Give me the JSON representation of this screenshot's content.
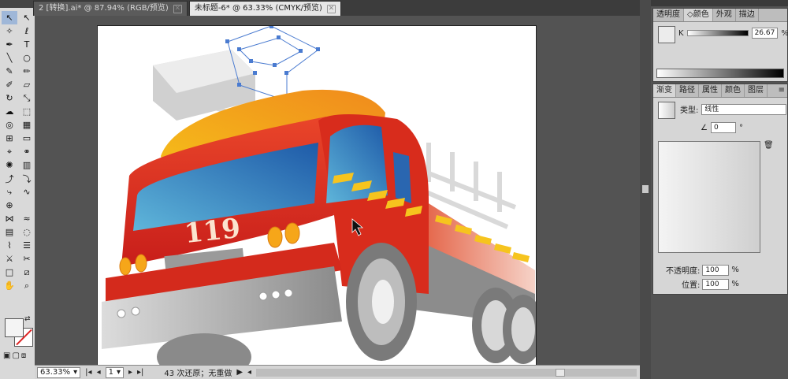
{
  "document_tabs": [
    {
      "label": "2 [转换].ai* @ 87.94% (RGB/预览)",
      "active": false
    },
    {
      "label": "未标题-6* @ 63.33% (CMYK/预览)",
      "active": true
    }
  ],
  "close_glyph": "✕",
  "toolbar": {
    "tools": [
      {
        "name": "selection-tool-icon",
        "glyph": "↖"
      },
      {
        "name": "direct-selection-tool-icon",
        "glyph": "↖"
      },
      {
        "name": "magic-wand-tool-icon",
        "glyph": "✧"
      },
      {
        "name": "lasso-tool-icon",
        "glyph": "ℓ"
      },
      {
        "name": "pen-tool-icon",
        "glyph": "✒"
      },
      {
        "name": "type-tool-icon",
        "glyph": "T"
      },
      {
        "name": "line-tool-icon",
        "glyph": "╲"
      },
      {
        "name": "ellipse-tool-icon",
        "glyph": "○"
      },
      {
        "name": "brush-tool-icon",
        "glyph": "✎"
      },
      {
        "name": "pencil-tool-icon",
        "glyph": "✏"
      },
      {
        "name": "blob-brush-tool-icon",
        "glyph": "✐"
      },
      {
        "name": "eraser-tool-icon",
        "glyph": "▱"
      },
      {
        "name": "rotate-tool-icon",
        "glyph": "↻"
      },
      {
        "name": "scale-tool-icon",
        "glyph": "⤡"
      },
      {
        "name": "warp-tool-icon",
        "glyph": "☁"
      },
      {
        "name": "free-transform-tool-icon",
        "glyph": "⬚"
      },
      {
        "name": "shape-builder-tool-icon",
        "glyph": "◎"
      },
      {
        "name": "perspective-grid-tool-icon",
        "glyph": "▦"
      },
      {
        "name": "mesh-tool-icon",
        "glyph": "⊞"
      },
      {
        "name": "gradient-tool-icon",
        "glyph": "▭"
      },
      {
        "name": "eyedropper-tool-icon",
        "glyph": "⌖"
      },
      {
        "name": "blend-tool-icon",
        "glyph": "⚭"
      },
      {
        "name": "symbol-sprayer-tool-icon",
        "glyph": "✺"
      },
      {
        "name": "column-graph-tool-icon",
        "glyph": "▥"
      },
      {
        "name": "add-anchor-tool-icon",
        "glyph": "⤴"
      },
      {
        "name": "convert-anchor-tool-icon",
        "glyph": "⤵"
      },
      {
        "name": "width-tool-icon",
        "glyph": "⤷"
      },
      {
        "name": "smooth-tool-icon",
        "glyph": "∿"
      },
      {
        "name": "target-tool-icon",
        "glyph": "⊕"
      },
      {
        "name": "blank-slot-icon",
        "glyph": ""
      },
      {
        "name": "envelope-tool-icon",
        "glyph": "⋈"
      },
      {
        "name": "wave-tool-icon",
        "glyph": "≈"
      },
      {
        "name": "grid-tool-icon",
        "glyph": "▤"
      },
      {
        "name": "twirl-tool-icon",
        "glyph": "◌"
      },
      {
        "name": "chart-tool-icon",
        "glyph": "⌇"
      },
      {
        "name": "list-tool-icon",
        "glyph": "☰"
      },
      {
        "name": "knife-tool-icon",
        "glyph": "⚔"
      },
      {
        "name": "scissors-tool-icon",
        "glyph": "✂"
      },
      {
        "name": "artboard-tool-icon",
        "glyph": "□"
      },
      {
        "name": "slice-tool-icon",
        "glyph": "⧄"
      },
      {
        "name": "hand-tool-icon",
        "glyph": "✋"
      },
      {
        "name": "zoom-tool-icon",
        "glyph": "⌕"
      }
    ],
    "swap_glyph": "⇄",
    "mode_glyphs": [
      "▣",
      "▢",
      "⧈"
    ]
  },
  "status_bar": {
    "zoom": "63.33%",
    "artboard_number": "1",
    "history": "43 次还原；无重做",
    "dropdown_glyph": "▾",
    "nav_glyphs": [
      "|◂",
      "◂",
      "▸",
      "▸|"
    ],
    "play_glyph": "▶",
    "scroll_glyph": "◂"
  },
  "artwork": {
    "number_text": "119"
  },
  "color_panel": {
    "tabs": [
      "透明度",
      "◇颜色",
      "外观",
      "描边"
    ],
    "active_tab": 1,
    "channel_label": "K",
    "channel_value": "26.67",
    "percent": "%"
  },
  "gradient_panel": {
    "tabs": [
      "渐变",
      "路径",
      "属性",
      "颜色",
      "图层"
    ],
    "active_tab": 0,
    "type_label": "类型:",
    "type_value": "线性",
    "angle_value": "0",
    "degree": "°",
    "opacity_label": "不透明度:",
    "opacity_value": "100",
    "location_label": "位置:",
    "location_value": "100",
    "percent": "%",
    "trash_glyph": "🗑",
    "panel_menu_glyph": "≡"
  }
}
